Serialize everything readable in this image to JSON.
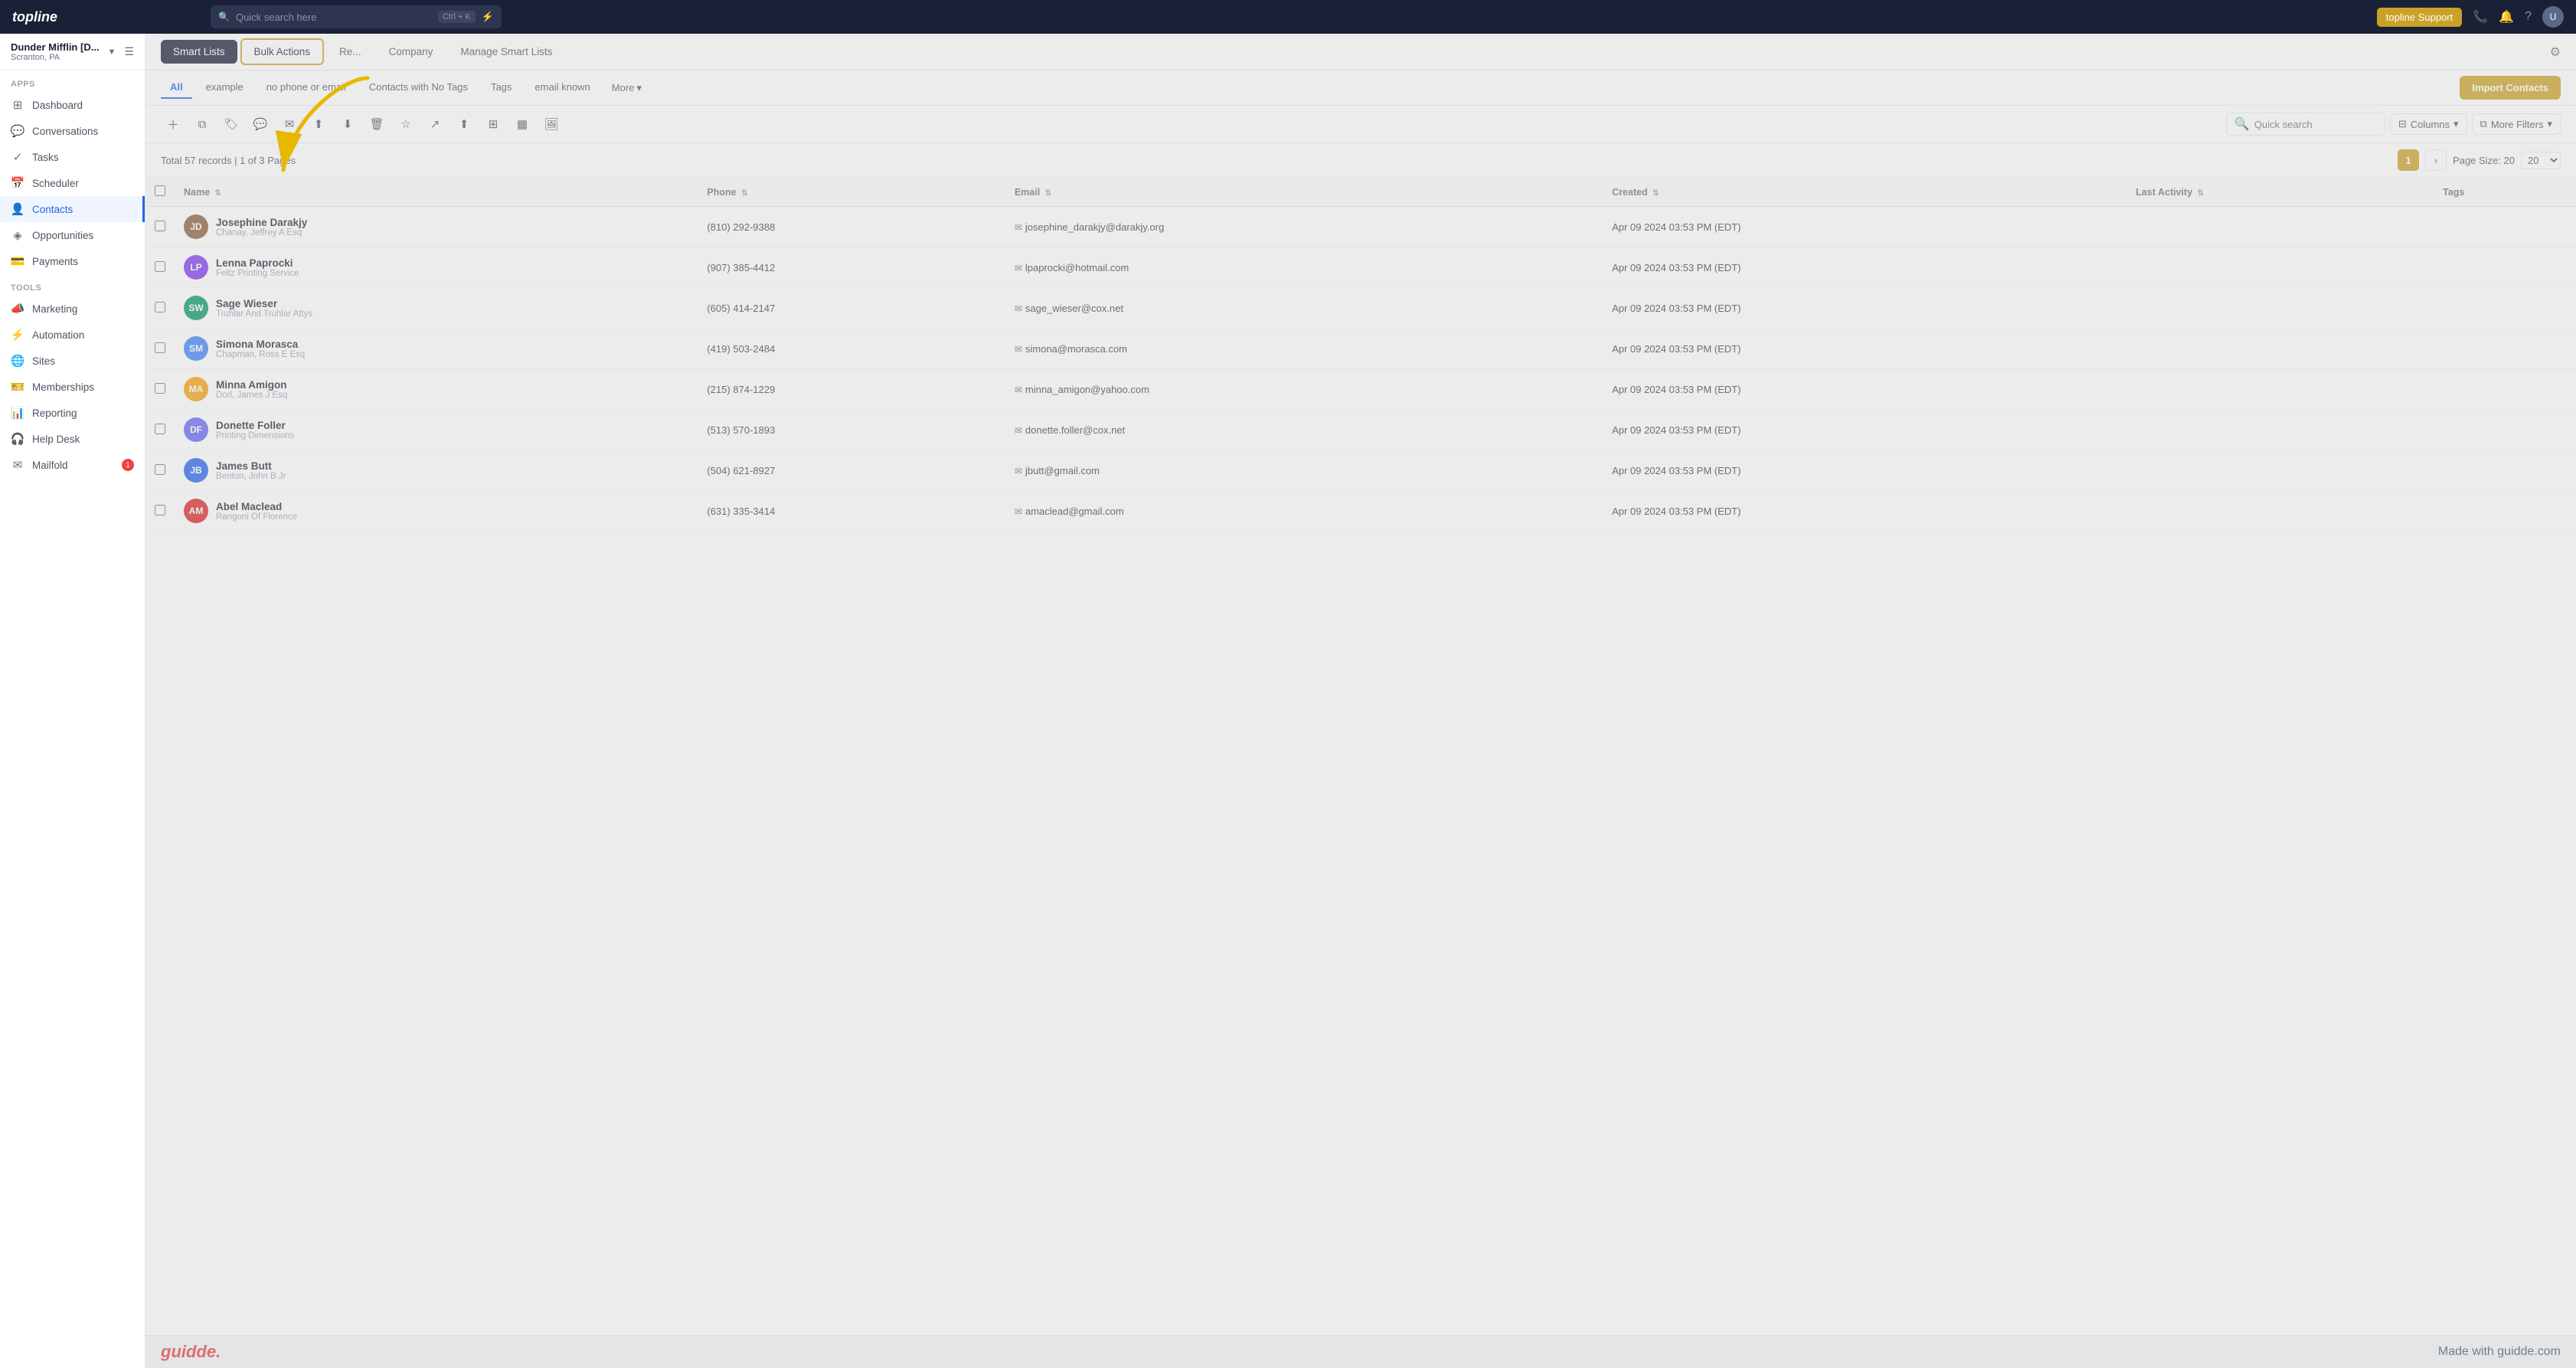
{
  "app": {
    "logo": "topline",
    "search_placeholder": "Quick search here",
    "search_shortcut": "Ctrl + K",
    "support_btn": "topline Support",
    "footer_logo": "guidde.",
    "footer_tagline": "Made with guidde.com"
  },
  "workspace": {
    "name": "Dunder Mifflin [D...",
    "location": "Scranton, PA"
  },
  "sidebar": {
    "apps_label": "Apps",
    "tools_label": "Tools",
    "items": [
      {
        "id": "dashboard",
        "label": "Dashboard",
        "icon": "⊞"
      },
      {
        "id": "conversations",
        "label": "Conversations",
        "icon": "💬"
      },
      {
        "id": "tasks",
        "label": "Tasks",
        "icon": "✓"
      },
      {
        "id": "scheduler",
        "label": "Scheduler",
        "icon": "📅"
      },
      {
        "id": "contacts",
        "label": "Contacts",
        "icon": "👤",
        "active": true
      },
      {
        "id": "opportunities",
        "label": "Opportunities",
        "icon": "◈"
      },
      {
        "id": "payments",
        "label": "Payments",
        "icon": "💳"
      },
      {
        "id": "marketing",
        "label": "Marketing",
        "icon": "📣"
      },
      {
        "id": "automation",
        "label": "Automation",
        "icon": "⚡"
      },
      {
        "id": "sites",
        "label": "Sites",
        "icon": "🌐"
      },
      {
        "id": "memberships",
        "label": "Memberships",
        "icon": "🎫"
      },
      {
        "id": "reporting",
        "label": "Reporting",
        "icon": "📊"
      },
      {
        "id": "helpdesk",
        "label": "Help Desk",
        "icon": "🎧"
      },
      {
        "id": "mailfold",
        "label": "Mailfold",
        "icon": "✉",
        "badge": "1"
      }
    ]
  },
  "tabs": {
    "items": [
      {
        "id": "smart-lists",
        "label": "Smart Lists",
        "active": true,
        "highlighted": false
      },
      {
        "id": "bulk-actions",
        "label": "Bulk Actions",
        "active": false,
        "highlighted": true
      },
      {
        "id": "reviews",
        "label": "Re...",
        "active": false,
        "highlighted": false
      },
      {
        "id": "company",
        "label": "Company",
        "active": false,
        "highlighted": false
      },
      {
        "id": "manage-smart-lists",
        "label": "Manage Smart Lists",
        "active": false,
        "highlighted": false
      }
    ],
    "settings_icon": "⚙"
  },
  "filter_tabs": {
    "items": [
      {
        "id": "all",
        "label": "All",
        "active": true
      },
      {
        "id": "example",
        "label": "example",
        "active": false
      },
      {
        "id": "no-phone",
        "label": "no phone or email",
        "active": false
      },
      {
        "id": "contacts-no-tags",
        "label": "Contacts with No Tags",
        "active": false
      },
      {
        "id": "tags",
        "label": "Tags",
        "active": false
      },
      {
        "id": "email-known",
        "label": "email known",
        "active": false
      }
    ],
    "more_label": "More",
    "import_btn": "Import Contacts"
  },
  "toolbar": {
    "quick_search_placeholder": "Quick search",
    "columns_btn": "Columns",
    "more_filters_btn": "More Filters"
  },
  "table": {
    "records_info": "Total 57 records | 1 of 3 Pages",
    "page_current": "1",
    "page_size_label": "Page Size: 20",
    "columns": [
      {
        "id": "name",
        "label": "Name"
      },
      {
        "id": "phone",
        "label": "Phone"
      },
      {
        "id": "email",
        "label": "Email"
      },
      {
        "id": "created",
        "label": "Created"
      },
      {
        "id": "last_activity",
        "label": "Last Activity"
      },
      {
        "id": "tags",
        "label": "Tags"
      }
    ],
    "rows": [
      {
        "id": 1,
        "initials": "JD",
        "avatar_color": "#8b5e3c",
        "name": "Josephine Darakjy",
        "company": "Chanay, Jeffrey A Esq",
        "phone": "(810) 292-9388",
        "email": "josephine_darakjy@darakjy.org",
        "created": "Apr 09 2024 03:53 PM (EDT)",
        "last_activity": ""
      },
      {
        "id": 2,
        "initials": "LP",
        "avatar_color": "#7c3aed",
        "name": "Lenna Paprocki",
        "company": "Feltz Printing Service",
        "phone": "(907) 385-4412",
        "email": "lpaprocki@hotmail.com",
        "created": "Apr 09 2024 03:53 PM (EDT)",
        "last_activity": ""
      },
      {
        "id": 3,
        "initials": "SW",
        "avatar_color": "#059669",
        "name": "Sage Wieser",
        "company": "Truhlar And Truhlar Attys",
        "phone": "(605) 414-2147",
        "email": "sage_wieser@cox.net",
        "created": "Apr 09 2024 03:53 PM (EDT)",
        "last_activity": ""
      },
      {
        "id": 4,
        "initials": "SM",
        "avatar_color": "#3b82f6",
        "name": "Simona Morasca",
        "company": "Chapman, Ross E Esq",
        "phone": "(419) 503-2484",
        "email": "simona@morasca.com",
        "created": "Apr 09 2024 03:53 PM (EDT)",
        "last_activity": ""
      },
      {
        "id": 5,
        "initials": "MA",
        "avatar_color": "#f59e0b",
        "name": "Minna Amigon",
        "company": "Dorl, James J Esq",
        "phone": "(215) 874-1229",
        "email": "minna_amigon@yahoo.com",
        "created": "Apr 09 2024 03:53 PM (EDT)",
        "last_activity": ""
      },
      {
        "id": 6,
        "initials": "DF",
        "avatar_color": "#6366f1",
        "name": "Donette Foller",
        "company": "Printing Dimensions",
        "phone": "(513) 570-1893",
        "email": "donette.foller@cox.net",
        "created": "Apr 09 2024 03:53 PM (EDT)",
        "last_activity": ""
      },
      {
        "id": 7,
        "initials": "JB",
        "avatar_color": "#2563eb",
        "name": "James Butt",
        "company": "Benton, John B Jr",
        "phone": "(504) 621-8927",
        "email": "jbutt@gmail.com",
        "created": "Apr 09 2024 03:53 PM (EDT)",
        "last_activity": ""
      },
      {
        "id": 8,
        "initials": "AM",
        "avatar_color": "#dc2626",
        "name": "Abel Maclead",
        "company": "Rangoni Of Florence",
        "phone": "(631) 335-3414",
        "email": "amaclead@gmail.com",
        "created": "Apr 09 2024 03:53 PM (EDT)",
        "last_activity": ""
      }
    ]
  }
}
